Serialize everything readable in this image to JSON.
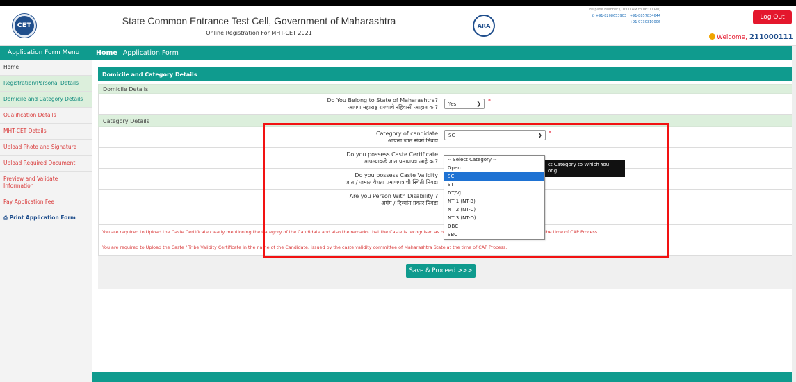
{
  "header": {
    "title": "State Common Entrance Test Cell, Government of Maharashtra",
    "subtitle": "Online Registration For MHT-CET 2021",
    "cet_logo_text": "CET",
    "ara_logo_text": "ARA",
    "helpline_label": "Helpline Number (10:00 AM to 06:00 PM)",
    "helpline_line1": "+91-8208653903 , +91-8857834644",
    "helpline_line2": "+91-9730310006",
    "logout_label": "Log Out",
    "welcome_label": "Welcome,",
    "user_id": "211000111"
  },
  "sidebar": {
    "title": "Application Form Menu",
    "items": [
      {
        "label": "Home"
      },
      {
        "label": "Registration/Personal Details"
      },
      {
        "label": "Domicile and Category Details"
      },
      {
        "label": "Qualification Details"
      },
      {
        "label": "MHT-CET Details"
      },
      {
        "label": "Upload Photo and Signature"
      },
      {
        "label": "Upload Required Document"
      },
      {
        "label": "Preview and Validate Information"
      },
      {
        "label": "Pay Application Fee"
      },
      {
        "label": "Print Application Form"
      }
    ]
  },
  "nav": {
    "home": "Home",
    "form": "Application Form"
  },
  "panel": {
    "title": "Domicile and Category Details",
    "domicile_section": "Domicile Details",
    "q_state_en": "Do You Belong to State of Maharashtra?",
    "q_state_mr": "आपण महाराष्ट्र राज्याचे रहिवासी आहात का?",
    "state_value": "Yes",
    "category_section": "Category Details",
    "q_category_en": "Category of candidate",
    "q_category_mr": "आपला जात संवर्ग निवडा",
    "category_value": "SC",
    "q_caste_cert_en": "Do you possess Caste Certificate",
    "q_caste_cert_mr": "आपल्याकडे जात प्रमाणपत्र आहे का?",
    "q_validity_en": "Do you possess Caste Validity",
    "q_validity_mr": "जात / जमात वैधता प्रमाणपत्राची स्थिती निवडा",
    "q_disability_en": "Are you Person With Disability ?",
    "q_disability_mr": "अपंग / दिव्यांग प्रकार निवडा",
    "warning1": "You are required to Upload the Caste Certificate clearly mentioning the Category of the Candidate and also the remarks that the Caste is recognised as backward class in the State of Maharashtra at the time of CAP Process.",
    "warning2": "You are required to Upload the Caste / Tribe Validity Certificate in the name of the Candidate, issued by the caste validity committee of Maharashtra State at the time of CAP Process.",
    "save_button": "Save & Proceed >>>",
    "required_mark": "*"
  },
  "dropdown": {
    "options": [
      "-- Select Category --",
      "Open",
      "SC",
      "ST",
      "DT/VJ",
      "NT 1 (NT-B)",
      "NT 2 (NT-C)",
      "NT 3 (NT-D)",
      "OBC",
      "SBC"
    ],
    "selected": "SC"
  },
  "tooltip": {
    "line1": "ct Category to Which You",
    "line2": "ong"
  },
  "colors": {
    "teal": "#0f9b8e",
    "red": "#e4172d",
    "highlight": "#f21212",
    "light_green": "#dcefdc",
    "select_blue": "#1e72d3"
  }
}
